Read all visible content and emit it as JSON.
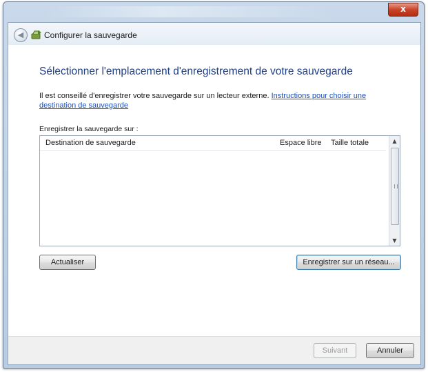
{
  "window": {
    "close_glyph": "x"
  },
  "header": {
    "back_glyph": "◀",
    "title": "Configurer la sauvegarde",
    "icon": "backup-wizard-icon"
  },
  "page": {
    "heading": "Sélectionner l'emplacement d'enregistrement de votre sauvegarde",
    "intro_text": "Il est conseillé d'enregistrer votre sauvegarde sur un lecteur externe.",
    "intro_link_line1": "Instructions pour choisir une",
    "intro_link_line2": "destination de sauvegarde",
    "save_label": "Enregistrer la sauvegarde sur :"
  },
  "table": {
    "columns": [
      "Destination de sauvegarde",
      "Espace libre",
      "Taille totale"
    ],
    "rows": []
  },
  "buttons": {
    "refresh": "Actualiser",
    "save_network": "Enregistrer sur un réseau...",
    "next": "Suivant",
    "cancel": "Annuler"
  }
}
